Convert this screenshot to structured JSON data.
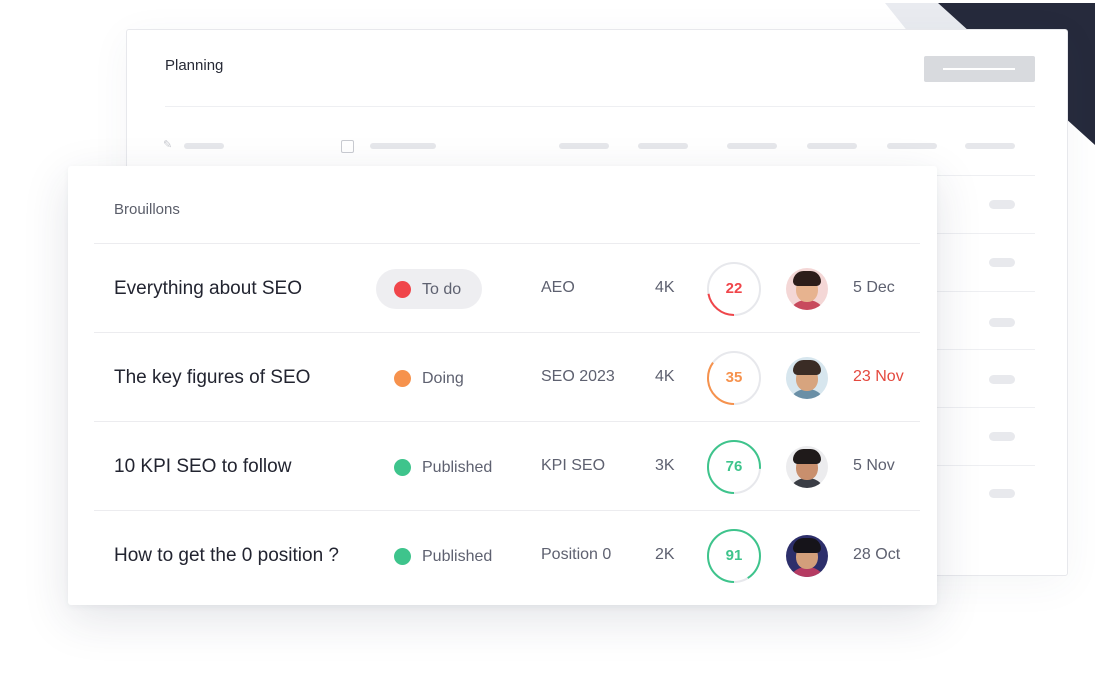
{
  "planning": {
    "title": "Planning"
  },
  "drafts": {
    "title": "Brouillons",
    "rows": [
      {
        "title": "Everything about SEO",
        "status": "To do",
        "status_color": "#f0454a",
        "status_highlight": true,
        "tag": "AEO",
        "volume": "4K",
        "score": 22,
        "score_color": "#f0454a",
        "avatar_name": "avatar-woman-icon",
        "date": "5 Dec",
        "date_late": false
      },
      {
        "title": "The key figures of SEO",
        "status": "Doing",
        "status_color": "#f6924d",
        "status_highlight": false,
        "tag": "SEO 2023",
        "volume": "4K",
        "score": 35,
        "score_color": "#f6924d",
        "avatar_name": "avatar-bearded-man-icon",
        "date": "23 Nov",
        "date_late": true
      },
      {
        "title": "10 KPI SEO to follow",
        "status": "Published",
        "status_color": "#3ec48c",
        "status_highlight": false,
        "tag": "KPI SEO",
        "volume": "3K",
        "score": 76,
        "score_color": "#3ec48c",
        "avatar_name": "avatar-glasses-woman-icon",
        "date": "5 Nov",
        "date_late": false
      },
      {
        "title": "How to get the 0 position ?",
        "status": "Published",
        "status_color": "#3ec48c",
        "status_highlight": false,
        "tag": "Position 0",
        "volume": "2K",
        "score": 91,
        "score_color": "#3ec48c",
        "avatar_name": "avatar-man-icon",
        "date": "28 Oct",
        "date_late": false
      }
    ]
  },
  "colors": {
    "accent_dark": "#262a3c",
    "late_date": "#e4493f"
  }
}
